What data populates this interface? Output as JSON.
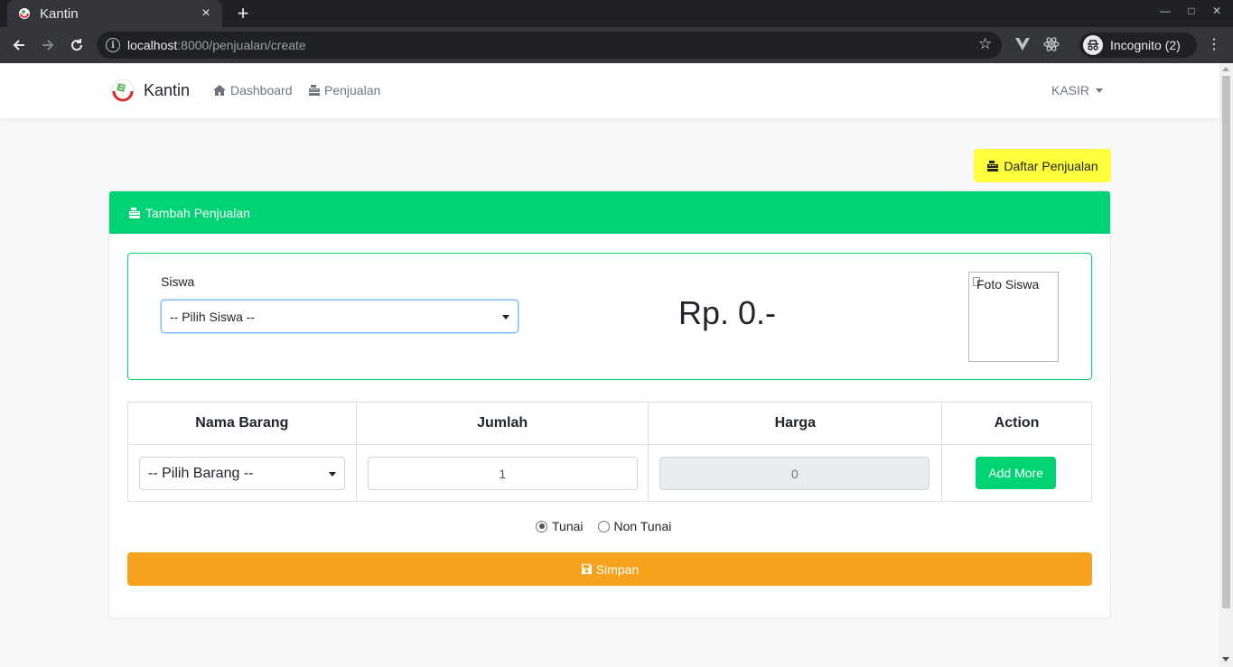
{
  "browser": {
    "tab_title": "Kantin",
    "new_tab": "+",
    "close_tab": "×",
    "url_host": "localhost",
    "url_path": ":8000/penjualan/create",
    "incognito_label": "Incognito (2)"
  },
  "navbar": {
    "brand": "Kantin",
    "links": [
      {
        "label": "Dashboard",
        "icon": "home-icon"
      },
      {
        "label": "Penjualan",
        "icon": "cash-register-icon"
      }
    ],
    "user": "KASIR"
  },
  "content": {
    "list_button": "Daftar Penjualan",
    "card_title": "Tambah Penjualan",
    "siswa_label": "Siswa",
    "siswa_select": "-- Pilih Siswa --",
    "total": "Rp. 0.-",
    "photo_alt": "Foto Siswa",
    "table": {
      "headers": [
        "Nama Barang",
        "Jumlah",
        "Harga",
        "Action"
      ],
      "row": {
        "barang_select": "-- Pilih Barang --",
        "jumlah": "1",
        "harga": "0",
        "action": "Add More"
      }
    },
    "payment": [
      {
        "label": "Tunai",
        "selected": true
      },
      {
        "label": "Non Tunai",
        "selected": false
      }
    ],
    "save_button": "Simpan"
  },
  "colors": {
    "primary_green": "#00d374",
    "yellow": "#ffff3b",
    "orange": "#f6a21d"
  }
}
